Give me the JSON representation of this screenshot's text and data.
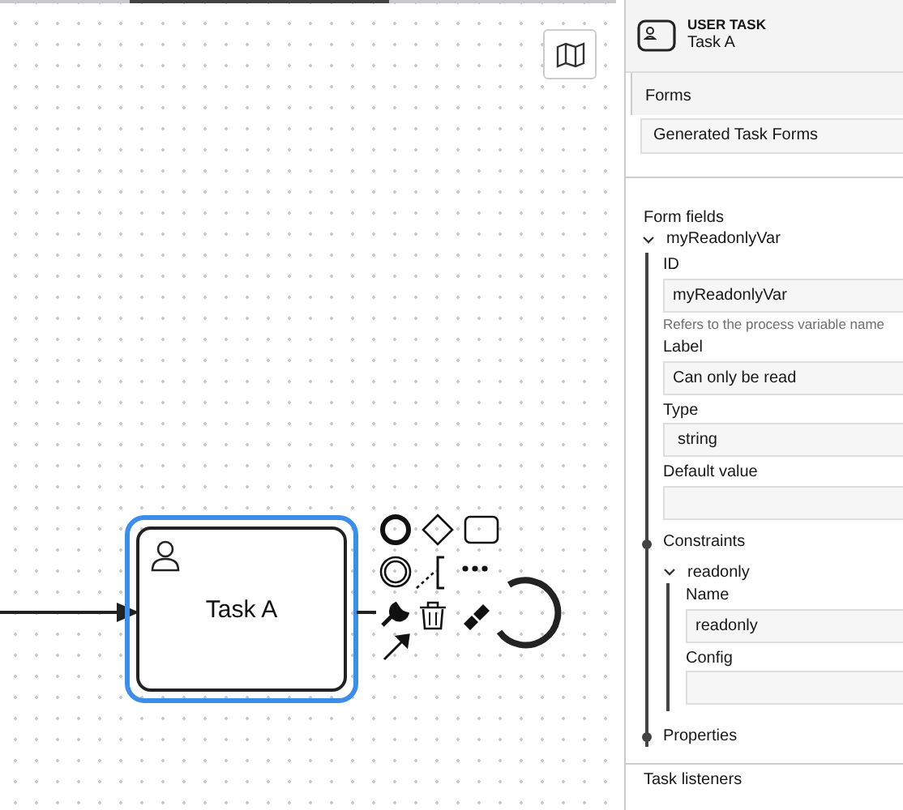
{
  "canvas": {
    "task": {
      "name": "Task A",
      "selected": true
    }
  },
  "panel": {
    "header": {
      "type": "USER TASK",
      "name": "Task A"
    },
    "forms": {
      "title": "Forms",
      "select": "Generated Task Forms"
    },
    "form_fields": {
      "title": "Form fields",
      "items": [
        {
          "name": "myReadonlyVar",
          "expanded": true,
          "fields": [
            {
              "kind": "input",
              "label": "ID",
              "value": "myReadonlyVar",
              "hint": "Refers to the process variable name"
            },
            {
              "kind": "input",
              "label": "Label",
              "value": "Can only be read"
            },
            {
              "kind": "select",
              "label": "Type",
              "value": "string"
            },
            {
              "kind": "input",
              "label": "Default value"
            }
          ],
          "constraints": {
            "title": "Constraints",
            "items": [
              {
                "name": "readonly",
                "expanded": true,
                "fields": [
                  {
                    "kind": "input",
                    "label": "Name",
                    "value": "readonly"
                  },
                  {
                    "kind": "input",
                    "label": "Config"
                  }
                ]
              }
            ]
          },
          "properties": {
            "title": "Properties"
          }
        }
      ]
    },
    "next_group": {
      "title": "Task listeners"
    }
  }
}
